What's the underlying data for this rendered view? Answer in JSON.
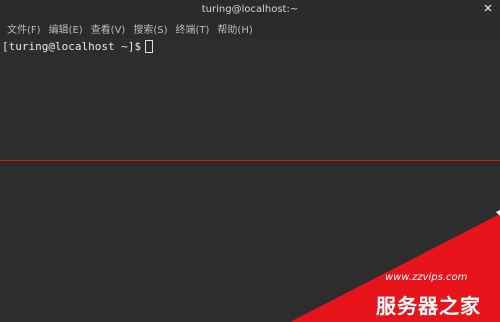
{
  "window": {
    "title": "turing@localhost:~",
    "close_icon": "close-icon"
  },
  "menu": {
    "items": [
      {
        "label": "文件(F)"
      },
      {
        "label": "编辑(E)"
      },
      {
        "label": "查看(V)"
      },
      {
        "label": "搜索(S)"
      },
      {
        "label": "终端(T)"
      },
      {
        "label": "帮助(H)"
      }
    ]
  },
  "terminal": {
    "prompt": "[turing@localhost ~]$"
  },
  "watermark": {
    "url": "www.zzvips.com",
    "name": "服务器之家"
  },
  "colors": {
    "background": "#2d2d2d",
    "text": "#e8e8e8",
    "guide_line": "#cc1c1c",
    "watermark_red": "#e8141c"
  }
}
